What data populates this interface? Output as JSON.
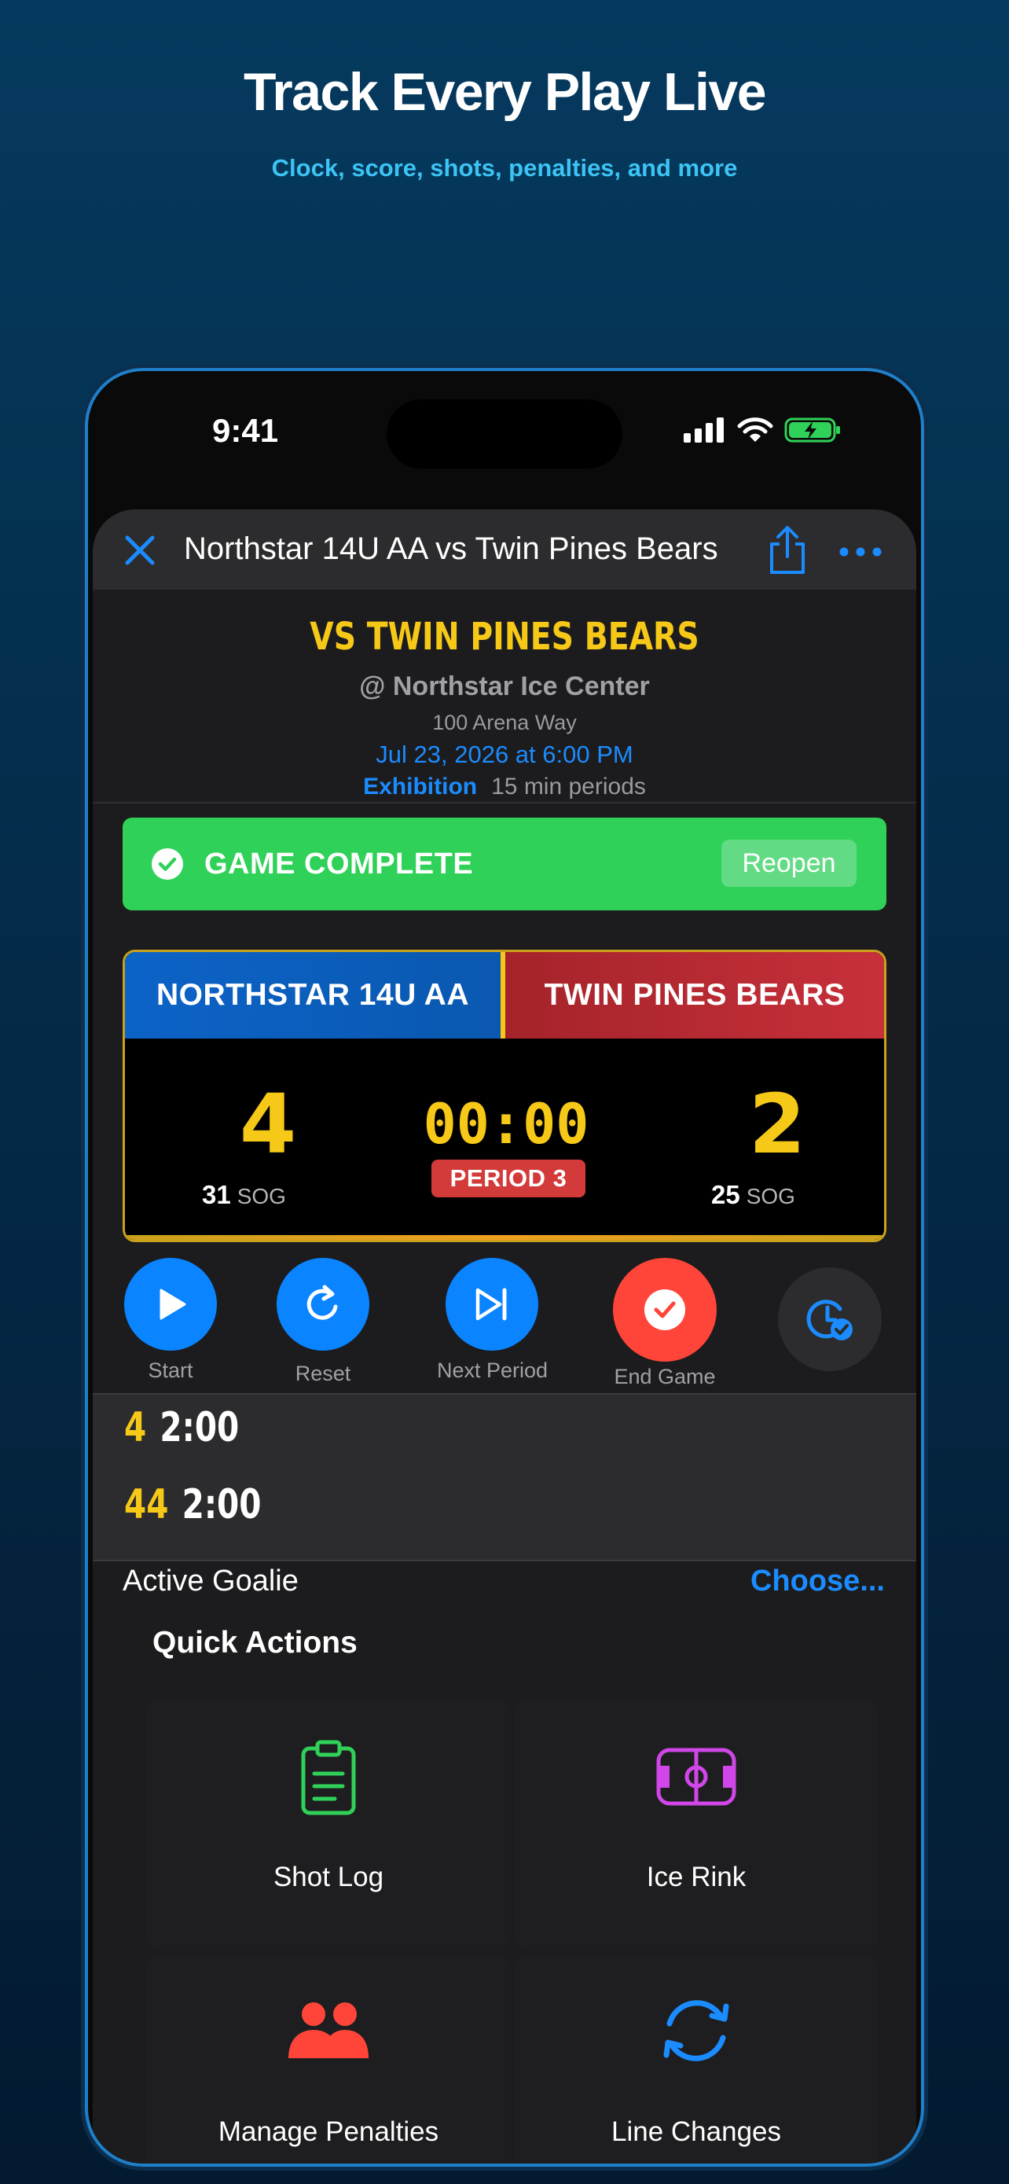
{
  "promo": {
    "title": "Track Every Play Live",
    "subtitle": "Clock, score, shots, penalties, and more"
  },
  "status_bar": {
    "time": "9:41"
  },
  "nav": {
    "title": "Northstar 14U AA vs Twin Pines Bears",
    "close_icon": "close-icon",
    "share_icon": "share-icon",
    "more_icon": "ellipsis-icon"
  },
  "game": {
    "opponent_title": "VS TWIN PINES BEARS",
    "venue": "@ Northstar Ice Center",
    "address": "100 Arena Way",
    "datetime": "Jul 23, 2026 at 6:00 PM",
    "type": "Exhibition",
    "periods": "15 min periods"
  },
  "status_banner": {
    "label": "GAME COMPLETE",
    "action": "Reopen",
    "color": "#30d158"
  },
  "scoreboard": {
    "home_team": "NORTHSTAR 14U AA",
    "away_team": "TWIN PINES BEARS",
    "home_score": "4",
    "away_score": "2",
    "clock": "00:00",
    "period": "PERIOD 3",
    "home_sog": "31",
    "away_sog": "25",
    "sog_label": "SOG",
    "home_color": "#0c63c7",
    "away_color": "#b8282f",
    "accent": "#f6c818"
  },
  "controls": {
    "start": "Start",
    "reset": "Reset",
    "next_period": "Next Period",
    "end_game": "End Game"
  },
  "penalties": [
    {
      "number": "4",
      "time": "2:00"
    },
    {
      "number": "44",
      "time": "2:00"
    }
  ],
  "goalie": {
    "label": "Active Goalie",
    "action": "Choose..."
  },
  "quick_actions": {
    "title": "Quick Actions",
    "items": [
      {
        "label": "Shot Log",
        "icon": "clipboard-icon",
        "color": "#30d158"
      },
      {
        "label": "Ice Rink",
        "icon": "rink-icon",
        "color": "#d046e8"
      },
      {
        "label": "Manage Penalties",
        "icon": "people-icon",
        "color": "#ff453a"
      },
      {
        "label": "Line Changes",
        "icon": "rotate-icon",
        "color": "#1a8cff"
      }
    ]
  }
}
